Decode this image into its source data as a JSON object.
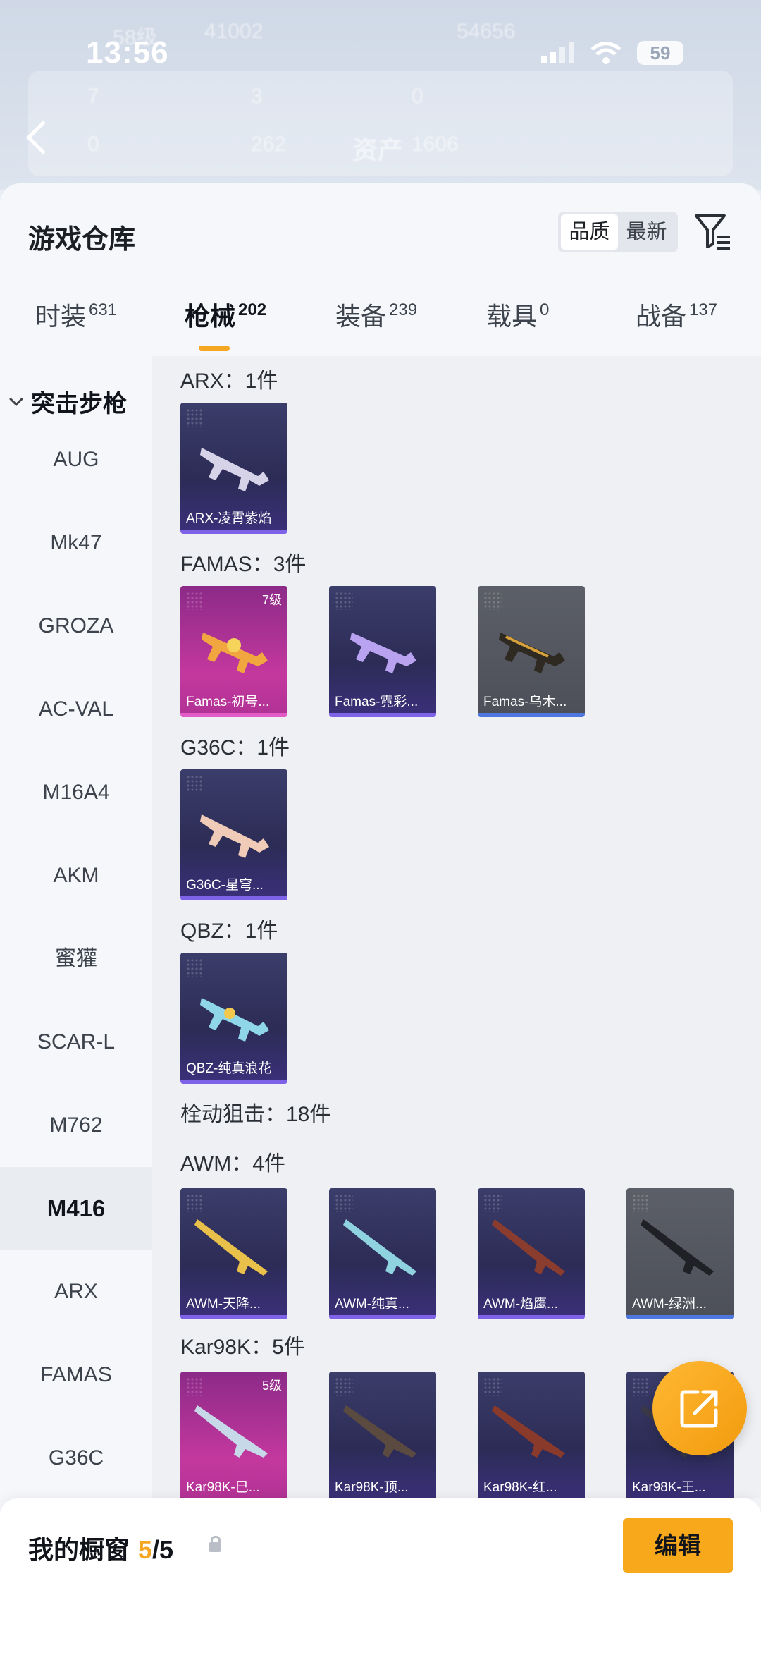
{
  "status_bar": {
    "time": "13:56",
    "battery": "59"
  },
  "background": {
    "ghost_text": [
      "58级",
      "41002",
      "54656",
      "7",
      "3",
      "0",
      "0",
      "262",
      "资产",
      "1606"
    ]
  },
  "header": {
    "title": "游戏仓库",
    "sort_options": [
      "品质",
      "最新"
    ],
    "active_sort": "品质"
  },
  "tabs": [
    {
      "label": "时装",
      "count": "631"
    },
    {
      "label": "枪械",
      "count": "202"
    },
    {
      "label": "装备",
      "count": "239"
    },
    {
      "label": "载具",
      "count": "0"
    },
    {
      "label": "战备",
      "count": "137"
    }
  ],
  "active_tab": "枪械",
  "sidebar": {
    "heading": "突击步枪",
    "items": [
      "AUG",
      "Mk47",
      "GROZA",
      "AC-VAL",
      "M16A4",
      "AKM",
      "蜜獾",
      "SCAR-L",
      "M762",
      "M416",
      "ARX",
      "FAMAS",
      "G36C"
    ],
    "active": "M416"
  },
  "groups": [
    {
      "label": "ARX：1件",
      "items": [
        {
          "name": "ARX-凌霄紫焰",
          "rarity": "purple"
        }
      ]
    },
    {
      "label": "FAMAS：3件",
      "items": [
        {
          "name": "Famas-初号...",
          "rarity": "pink",
          "level": "7级"
        },
        {
          "name": "Famas-霓彩...",
          "rarity": "purple"
        },
        {
          "name": "Famas-乌木...",
          "rarity": "gray"
        }
      ]
    },
    {
      "label": "G36C：1件",
      "items": [
        {
          "name": "G36C-星穹...",
          "rarity": "purple"
        }
      ]
    },
    {
      "label": "QBZ：1件",
      "items": [
        {
          "name": "QBZ-纯真浪花",
          "rarity": "purple"
        }
      ]
    },
    {
      "label": "栓动狙击：18件",
      "items": []
    },
    {
      "label": "AWM：4件",
      "items": [
        {
          "name": "AWM-天降...",
          "rarity": "purple"
        },
        {
          "name": "AWM-纯真...",
          "rarity": "purple"
        },
        {
          "name": "AWM-焰鹰...",
          "rarity": "purple"
        },
        {
          "name": "AWM-绿洲...",
          "rarity": "gray"
        }
      ]
    },
    {
      "label": "Kar98K：5件",
      "items": [
        {
          "name": "Kar98K-巳...",
          "rarity": "pink",
          "level": "5级"
        },
        {
          "name": "Kar98K-顶...",
          "rarity": "purple"
        },
        {
          "name": "Kar98K-红...",
          "rarity": "purple"
        },
        {
          "name": "Kar98K-王...",
          "rarity": "purple"
        }
      ]
    }
  ],
  "bottom_bar": {
    "title": "我的橱窗",
    "count_filled": "5",
    "count_total": "/5",
    "edit_label": "编辑"
  },
  "colors": {
    "accent": "#f5a623",
    "purple_rarity": "#7e62e8",
    "pink_rarity": "#e25cc8",
    "gray_rarity": "#4e78e0"
  }
}
